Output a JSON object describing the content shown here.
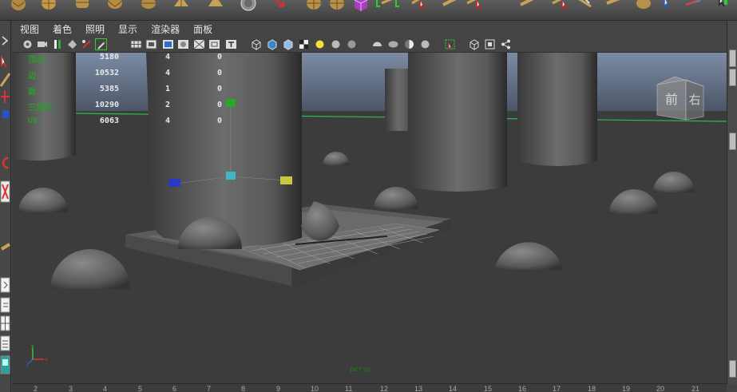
{
  "menu": {
    "view": "视图",
    "shading": "着色",
    "lighting": "照明",
    "show": "显示",
    "renderer": "渲染器",
    "panels": "面板"
  },
  "hud": {
    "rows": [
      {
        "label": "顶点:",
        "total": "5180",
        "selected": "4",
        "components": "0"
      },
      {
        "label": "边:",
        "total": "10532",
        "selected": "4",
        "components": "0"
      },
      {
        "label": "面:",
        "total": "5385",
        "selected": "1",
        "components": "0"
      },
      {
        "label": "三角形:",
        "total": "10290",
        "selected": "2",
        "components": "0"
      },
      {
        "label": "UV:",
        "total": "6063",
        "selected": "4",
        "components": "0"
      }
    ]
  },
  "viewcube": {
    "front": "前",
    "right": "右"
  },
  "camera": {
    "name": "persp"
  },
  "ruler": {
    "ticks": [
      "2",
      "3",
      "4",
      "5",
      "6",
      "7",
      "8",
      "9",
      "10",
      "11",
      "12",
      "13",
      "14",
      "15",
      "16",
      "17",
      "18",
      "19",
      "20",
      "21"
    ]
  },
  "colors": {
    "hud_label": "#2c9a2c",
    "sky_top": "#7f8ea5",
    "ground": "#3b3b3b",
    "horizon": "#31b24f",
    "manip_green": "#27a827",
    "manip_blue": "#2b38c4",
    "manip_yellow": "#c8c83a",
    "manip_cyan": "#3fb7c4"
  },
  "icons": {
    "shelf": [
      "cube-icon",
      "sphere-icon",
      "cylinder-icon",
      "cone-icon",
      "torus-icon",
      "plane-icon",
      "pyramid-icon",
      "sphere-icon",
      "pipe-icon",
      "arrow-icon",
      "sphere-icon",
      "prism-icon",
      "curve-icon",
      "cursor-icon",
      "plane-icon",
      "cursor-icon",
      "plane-icon",
      "cursor-icon",
      "wedge-icon",
      "wedge-icon"
    ],
    "toolbar": [
      "camera-icon",
      "camera-attributes-icon",
      "bookmark-icon",
      "image-plane-icon",
      "2d-pan-icon",
      "grease-pencil-icon",
      "grid-icon",
      "film-gate-icon",
      "resolution-gate-icon",
      "gate-mask-icon",
      "field-chart-icon",
      "safe-title-icon",
      "wireframe-icon",
      "smooth-shade-icon",
      "shade-all-icon",
      "textured-icon",
      "default-light-icon",
      "shadows-icon",
      "screen-ao-icon",
      "motion-blur-icon",
      "anti-alias-icon",
      "dof-icon",
      "select-camera-icon",
      "isolate-icon",
      "xray-icon",
      "xray-joints-icon"
    ]
  }
}
